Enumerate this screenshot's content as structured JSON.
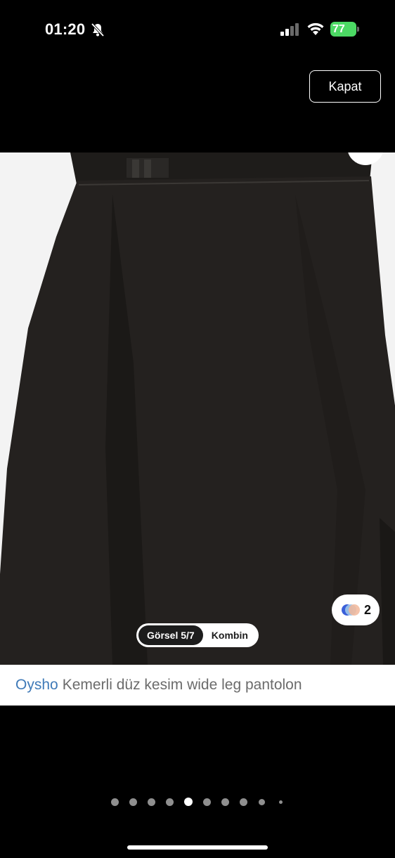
{
  "status_bar": {
    "time": "01:20",
    "battery": "77",
    "battery_color": "#4cd964",
    "icons": [
      "bell-slash-icon",
      "cellular-signal-icon",
      "wifi-icon",
      "battery-charging-icon"
    ]
  },
  "header": {
    "close_label": "Kapat"
  },
  "gallery": {
    "view_tabs": {
      "active_label": "Görsel 5/7",
      "inactive_label": "Kombin"
    },
    "color_option_count": "2",
    "current_index": 5,
    "total_dots": 10
  },
  "product": {
    "brand": "Oysho",
    "title": "Kemerli düz kesim wide leg pantolon",
    "brand_color": "#3f7ab8"
  }
}
